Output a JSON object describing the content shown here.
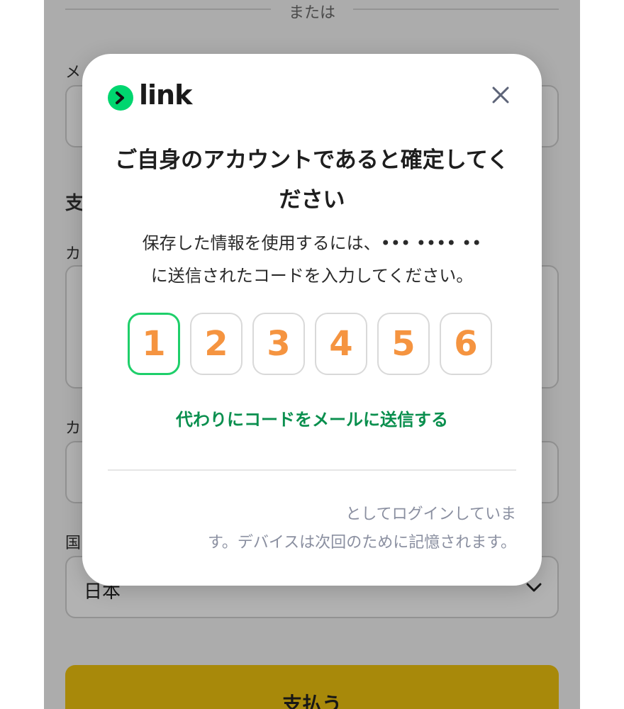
{
  "background": {
    "divider_text": "または",
    "email_label": "メ",
    "section_label": "支",
    "card_label": "カ",
    "card_label_2": "カ",
    "country_label": "国",
    "country_value": "日本",
    "pay_button": "支払う"
  },
  "modal": {
    "logo_text": "link",
    "title": "ご自身のアカウントであると確定してください",
    "description_line1": "保存した情報を使用するには、••• •••• ••",
    "description_line2": "に送信されたコードを入力してください。",
    "otp_digits": [
      "1",
      "2",
      "3",
      "4",
      "5",
      "6"
    ],
    "send_email_link": "代わりにコードをメールに送信する",
    "footer_line1": "としてログインしていま",
    "footer_line2": "す。デバイスは次回のために記憶されます。"
  },
  "colors": {
    "brand_green": "#00d66f",
    "link_green": "#0a8f4e",
    "digit_orange": "#f59440",
    "pay_button_yellow": "#f1c40f"
  }
}
